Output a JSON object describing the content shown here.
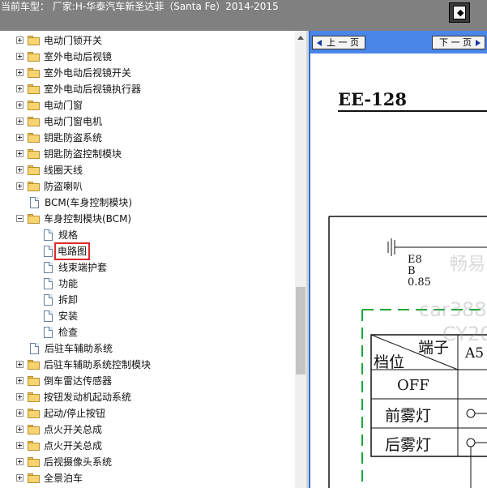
{
  "header": {
    "title": "当前车型： 厂家:H-华泰汽车新圣达菲（Santa Fe）2014-2015",
    "panel_toggle_glyph": "◆"
  },
  "tree": {
    "items": [
      {
        "label": "电动门锁开关",
        "type": "folder",
        "expander": "plus",
        "level": 1
      },
      {
        "label": "室外电动后视镜",
        "type": "folder",
        "expander": "plus",
        "level": 1
      },
      {
        "label": "室外电动后视镜开关",
        "type": "folder",
        "expander": "plus",
        "level": 1
      },
      {
        "label": "室外电动后视镜执行器",
        "type": "folder",
        "expander": "plus",
        "level": 1
      },
      {
        "label": "电动门窗",
        "type": "folder",
        "expander": "plus",
        "level": 1
      },
      {
        "label": "电动门窗电机",
        "type": "folder",
        "expander": "plus",
        "level": 1
      },
      {
        "label": "钥匙防盗系统",
        "type": "folder",
        "expander": "plus",
        "level": 1
      },
      {
        "label": "钥匙防盗控制模块",
        "type": "folder",
        "expander": "plus",
        "level": 1
      },
      {
        "label": "线圈天线",
        "type": "folder",
        "expander": "plus",
        "level": 1
      },
      {
        "label": "防盗喇叭",
        "type": "folder",
        "expander": "plus",
        "level": 1
      },
      {
        "label": "BCM(车身控制模块)",
        "type": "doc",
        "expander": "none",
        "level": 1
      },
      {
        "label": "车身控制模块(BCM)",
        "type": "folder",
        "expander": "minus",
        "level": 1
      },
      {
        "label": "规格",
        "type": "doc",
        "expander": "none",
        "level": 2
      },
      {
        "label": "电路图",
        "type": "doc",
        "expander": "none",
        "level": 2,
        "selected": true
      },
      {
        "label": "线束端护套",
        "type": "doc",
        "expander": "none",
        "level": 2
      },
      {
        "label": "功能",
        "type": "doc",
        "expander": "none",
        "level": 2
      },
      {
        "label": "拆卸",
        "type": "doc",
        "expander": "none",
        "level": 2
      },
      {
        "label": "安装",
        "type": "doc",
        "expander": "none",
        "level": 2
      },
      {
        "label": "检查",
        "type": "doc",
        "expander": "none",
        "level": 2
      },
      {
        "label": "后驻车辅助系统",
        "type": "doc",
        "expander": "none",
        "level": 1
      },
      {
        "label": "后驻车辅助系统控制模块",
        "type": "folder",
        "expander": "plus",
        "level": 1
      },
      {
        "label": "倒车雷达传感器",
        "type": "folder",
        "expander": "plus",
        "level": 1
      },
      {
        "label": "按钮发动机起动系统",
        "type": "folder",
        "expander": "plus",
        "level": 1
      },
      {
        "label": "起动/停止按钮",
        "type": "folder",
        "expander": "plus",
        "level": 1
      },
      {
        "label": "点火开关总成",
        "type": "folder",
        "expander": "plus",
        "level": 1
      },
      {
        "label": "点火开关总成",
        "type": "folder",
        "expander": "plus",
        "level": 1
      },
      {
        "label": "后视摄像头系统",
        "type": "folder",
        "expander": "plus",
        "level": 1
      },
      {
        "label": "全景泊车",
        "type": "folder",
        "expander": "plus",
        "level": 1
      }
    ]
  },
  "viewer": {
    "prev_label": "上 一 页",
    "next_label": "下 一 页",
    "page_code": "EE-128",
    "watermark_1": "畅易",
    "watermark_2": "car388",
    "watermark_3": "CY20",
    "wire_1": "E8",
    "wire_2": "B",
    "wire_3": "0.85",
    "table": {
      "header_corner_top": "端子",
      "header_corner_bottom": "档位",
      "col_1": "A5",
      "row_1": "OFF",
      "row_2": "前雾灯",
      "row_3": "后雾灯"
    }
  }
}
